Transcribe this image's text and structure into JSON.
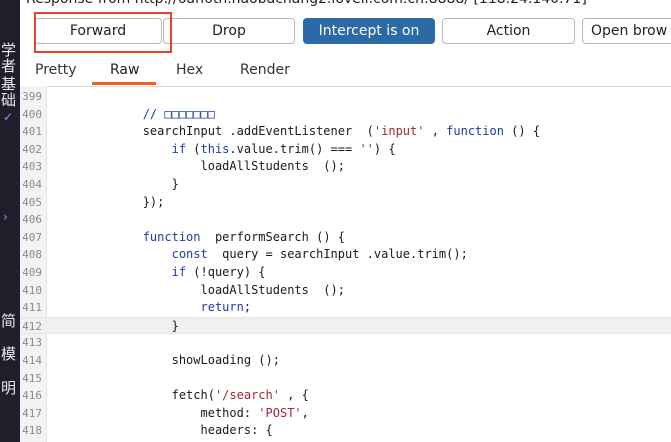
{
  "window": {
    "title": "Response from http://6an6th.haobachang2.loveli.com.cn:8888/  [118.24.140.71]"
  },
  "background_window": {
    "glyphs": [
      "学者",
      "基础",
      "简",
      "模",
      "明"
    ]
  },
  "toolbar": {
    "forward_label": "Forward",
    "drop_label": "Drop",
    "intercept_label": "Intercept is on",
    "action_label": "Action",
    "open_browser_label": "Open brow"
  },
  "tabs": [
    {
      "label": "Pretty"
    },
    {
      "label": "Raw",
      "active": true
    },
    {
      "label": "Hex"
    },
    {
      "label": "Render"
    }
  ],
  "colors": {
    "intercept_button": "#2b6aa7",
    "highlight_box": "#e8432a",
    "active_tab_underline": "#e8632a",
    "keyword": "#1a3fa8",
    "string": "#a3253b"
  },
  "code": {
    "current_line": 412,
    "lines": [
      {
        "n": "399",
        "t": ""
      },
      {
        "n": "400",
        "t": "            // □□□□□□□"
      },
      {
        "n": "401",
        "t": "            searchInput .addEventListener  ('input' , function () {"
      },
      {
        "n": "402",
        "t": "                if (this.value.trim() === '') {"
      },
      {
        "n": "403",
        "t": "                    loadAllStudents  ();"
      },
      {
        "n": "404",
        "t": "                }"
      },
      {
        "n": "405",
        "t": "            });"
      },
      {
        "n": "406",
        "t": ""
      },
      {
        "n": "407",
        "t": "            function  performSearch () {"
      },
      {
        "n": "408",
        "t": "                const  query = searchInput .value.trim();"
      },
      {
        "n": "409",
        "t": "                if (!query) {"
      },
      {
        "n": "410",
        "t": "                    loadAllStudents  ();"
      },
      {
        "n": "411",
        "t": "                    return;"
      },
      {
        "n": "412",
        "t": "                }"
      },
      {
        "n": "413",
        "t": ""
      },
      {
        "n": "414",
        "t": "                showLoading ();"
      },
      {
        "n": "415",
        "t": ""
      },
      {
        "n": "416",
        "t": "                fetch('/search' , {"
      },
      {
        "n": "417",
        "t": "                    method: 'POST',"
      },
      {
        "n": "418",
        "t": "                    headers: {"
      }
    ]
  }
}
